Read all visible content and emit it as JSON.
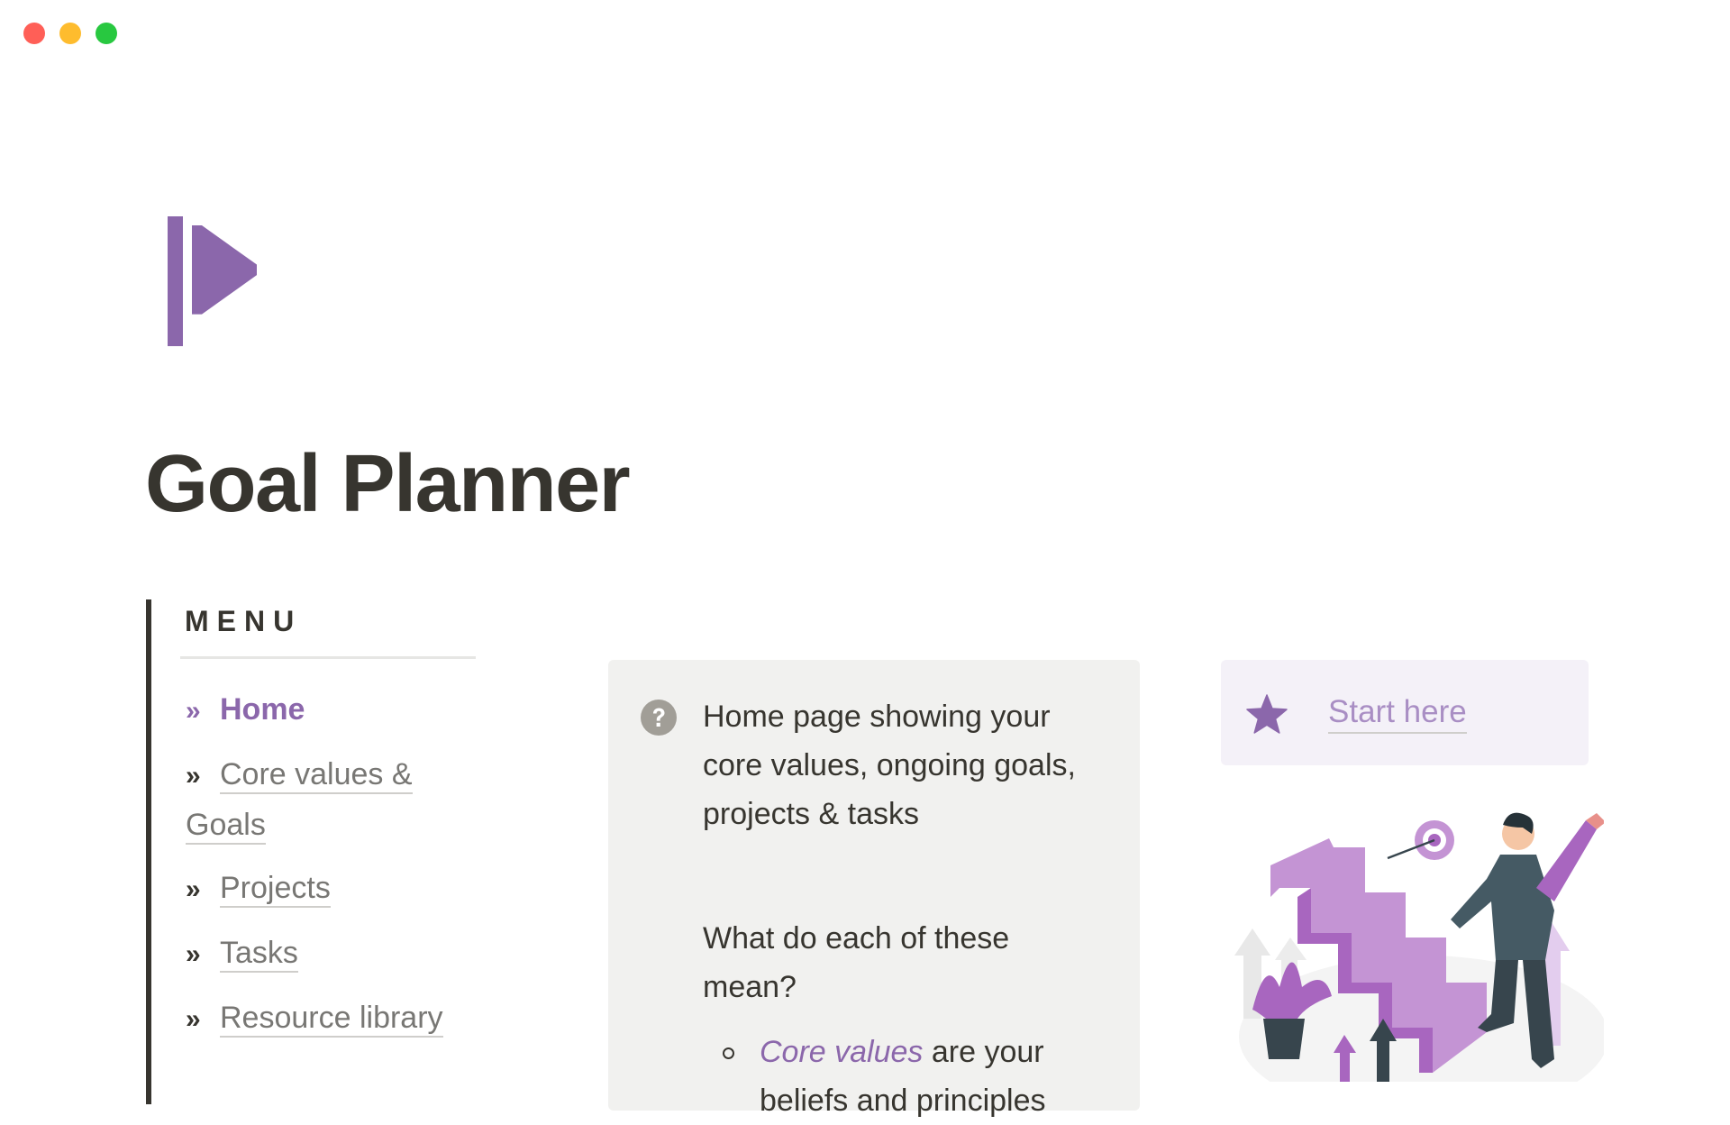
{
  "window": {
    "controls": [
      "close",
      "minimize",
      "maximize"
    ]
  },
  "page": {
    "icon": "flag-icon",
    "title": "Goal Planner"
  },
  "menu": {
    "heading": "MENU",
    "chevron": "»",
    "items": [
      {
        "label": "Home",
        "active": true
      },
      {
        "label": "Core values & Goals",
        "active": false
      },
      {
        "label": "Projects",
        "active": false
      },
      {
        "label": "Tasks",
        "active": false
      },
      {
        "label": "Resource library",
        "active": false
      }
    ]
  },
  "info_callout": {
    "icon": "question-circle-icon",
    "description": "Home page showing your core values, ongoing goals, projects & tasks",
    "question": "What do each of these mean?",
    "bullets": [
      {
        "highlight": "Core values",
        "text": " are your",
        "continuation": "beliefs and principles"
      }
    ]
  },
  "start_callout": {
    "icon": "star-icon",
    "link_label": "Start here"
  },
  "illustration": {
    "alt": "person-climbing-stairs-illustration"
  },
  "colors": {
    "accent": "#8b67ab",
    "text": "#37352f",
    "muted": "#787774",
    "callout_gray": "#f1f1ef",
    "callout_purple": "#f4f1f8"
  }
}
